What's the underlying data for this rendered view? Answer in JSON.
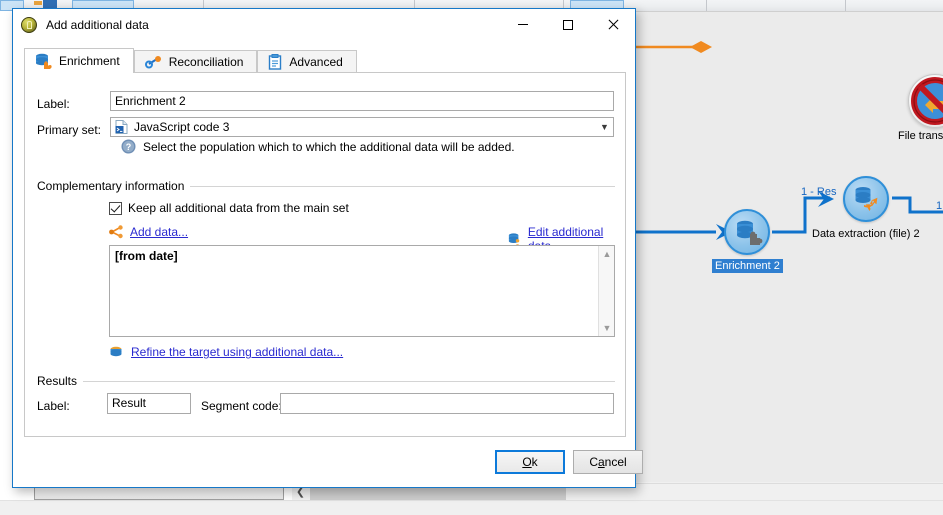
{
  "dialog": {
    "title": "Add additional data",
    "title_icon": "app-circle-icon",
    "window_controls": {
      "minimize": "minimize-icon",
      "maximize": "maximize-icon",
      "close": "close-icon"
    },
    "tabs": [
      {
        "label": "Enrichment",
        "icon": "database-puzzle-icon",
        "active": true
      },
      {
        "label": "Reconciliation",
        "icon": "link-chain-icon",
        "active": false
      },
      {
        "label": "Advanced",
        "icon": "clipboard-icon",
        "active": false
      }
    ],
    "fields": {
      "label_caption": "Label:",
      "label_value": "Enrichment 2",
      "primary_set_caption": "Primary set:",
      "primary_set_value": "JavaScript code 3",
      "primary_set_icon": "javascript-file-icon",
      "primary_set_arrow": "chevron-down-icon",
      "hint_icon": "help-question-icon",
      "hint_text": "Select the population which to which the additional data will be added."
    },
    "complementary": {
      "group_title": "Complementary information",
      "checkbox_label": "Keep all additional data from the main set",
      "checkbox_checked": true,
      "add_data_link": "Add data...",
      "add_data_icon": "share-nodes-icon",
      "edit_data_link": "Edit additional data...",
      "edit_data_icon": "database-user-icon",
      "list_items": [
        "[from date]"
      ],
      "scroll_up_icon": "chevron-up-icon",
      "scroll_down_icon": "chevron-down-icon",
      "refine_link": "Refine the target using additional data...",
      "refine_icon": "database-small-icon"
    },
    "results": {
      "group_title": "Results",
      "label_caption": "Label:",
      "label_value": "Result",
      "segment_caption": "Segment code:",
      "segment_value": ""
    },
    "buttons": {
      "ok_prefix": "O",
      "ok_suffix": "k",
      "cancel_prefix": "C",
      "cancel_mnemonic": "a",
      "cancel_suffix": "ncel"
    }
  },
  "workflow": {
    "nodes": [
      {
        "label": "Enrichment 2",
        "icon": "database-puzzle-icon",
        "selected": true
      },
      {
        "label": "Data extraction (file) 2",
        "icon": "database-export-icon",
        "selected": false
      },
      {
        "label": "File trans",
        "icon": "file-transfer-blocked-icon",
        "selected": false
      }
    ],
    "edge_labels": [
      "1 - Res",
      "1"
    ]
  },
  "bottom": {
    "scroll_left_icon": "chevron-left-icon"
  },
  "colors": {
    "accent": "#0d7ada",
    "link": "#2a2ad0",
    "node_border": "#2f8fd8",
    "edge": "#0f72cb",
    "orange": "#f08a20",
    "selection": "#2f7fd0"
  }
}
